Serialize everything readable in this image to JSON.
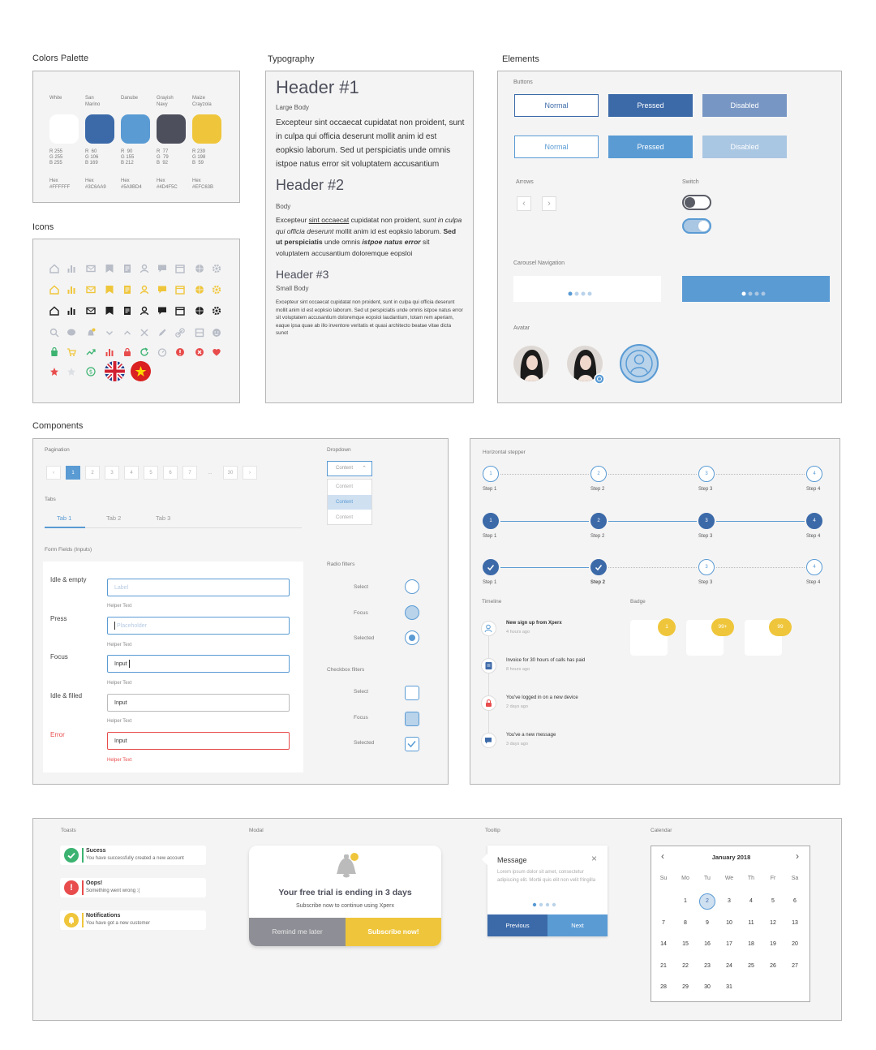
{
  "titles": {
    "colors": "Colors Palette",
    "typography": "Typography",
    "elements": "Elements",
    "icons": "Icons",
    "components": "Components"
  },
  "palette": [
    {
      "name": "White",
      "rgb": "R 255\nG 255\nB 255",
      "hex": "Hex\n#FFFFFF",
      "color": "#FFFFFF"
    },
    {
      "name": "San\nMarino",
      "rgb": "R  60\nG 106\nB 169",
      "hex": "Hex\n#3C6AA9",
      "color": "#3C6AA9"
    },
    {
      "name": "Danube",
      "rgb": "R  90\nG 155\nB 212",
      "hex": "Hex\n#5A9BD4",
      "color": "#5A9BD4"
    },
    {
      "name": "Grayish\nNavy",
      "rgb": "R  77\nG  79\nB  92",
      "hex": "Hex\n#4D4F5C",
      "color": "#4D4F5C"
    },
    {
      "name": "Maize\nCrayzola",
      "rgb": "R 239\nG 198\nB  59",
      "hex": "Hex\n#EFC63B",
      "color": "#EFC63B"
    }
  ],
  "typography": {
    "h1": "Header #1",
    "large_label": "Large Body",
    "large_text": "Excepteur sint occaecat cupidatat non proident, sunt in culpa qui officia deserunt mollit anim id est eopksio laborum. Sed ut perspiciatis unde omnis istpoe natus error sit voluptatem accusantium",
    "h2": "Header #2",
    "body_label": "Body",
    "body_p1": "Excepteur ",
    "body_u": "sint occaecat",
    "body_p2": " cupidatat non proident, ",
    "body_i": "sunt in culpa qui officia deserunt",
    "body_p3": " mollit anim id est eopksio laborum. ",
    "body_b": "Sed ut perspiciatis",
    "body_p4": " unde omnis ",
    "body_bi": "istpoe natus error",
    "body_p5": " sit voluptatem accusantium doloremque eopsloi",
    "h3": "Header #3",
    "small_label": "Small Body",
    "small_text": "Excepteur sint occaecat cupidatat non proident, sunt in culpa qui officia deserunt mollit anim id est eopksio laborum. Sed ut perspiciatis unde omnis istpoe natus error sit voluptatem accusantium doloremque eopsloi laudantium, totam rem aperiam, eaque ipsa quae ab illo inventore veritatis et quasi architecto beatae vitae dicta sunot"
  },
  "elements": {
    "buttons_label": "Buttons",
    "row1": {
      "normal": "Normal",
      "pressed": "Pressed",
      "disabled": "Disabled"
    },
    "row2": {
      "normal": "Normal",
      "pressed": "Pressed",
      "disabled": "Disabled"
    },
    "arrows_label": "Arrows",
    "switch_label": "Switch",
    "carousel_label": "Carousel Navigation",
    "avatar_label": "Avatar"
  },
  "components": {
    "pagination_label": "Pagination",
    "pages": [
      "1",
      "2",
      "3",
      "4",
      "5",
      "6",
      "7",
      "...",
      "30"
    ],
    "tabs_label": "Tabs",
    "tabs": [
      "Tab 1",
      "Tab 2",
      "Tab 3"
    ],
    "form_label": "Form Fields (Inputs)",
    "fields": [
      {
        "state": "Idle & empty",
        "value": "Label",
        "helper": "Helper Text"
      },
      {
        "state": "Press",
        "value": "Placeholder",
        "helper": "Helper Text"
      },
      {
        "state": "Focus",
        "value": "Input",
        "helper": "Helper Text"
      },
      {
        "state": "Idle & filled",
        "value": "Input",
        "helper": "Helper Text"
      },
      {
        "state": "Error",
        "value": "Input",
        "helper": "Helper Text"
      }
    ],
    "dropdown_label": "Dropdown",
    "dropdown_value": "Content",
    "dropdown_options": [
      "Content",
      "Content",
      "Content"
    ],
    "radio_label": "Radio filters",
    "checkbox_label": "Checkbox filters",
    "filter_states": [
      "Select",
      "Focus",
      "Selected"
    ]
  },
  "stepper": {
    "label": "Horizontal stepper",
    "rows": [
      {
        "nums": [
          "1",
          "2",
          "3",
          "4"
        ],
        "labels": [
          "Step 1",
          "Step 2",
          "Step 3",
          "Step 4"
        ]
      },
      {
        "nums": [
          "1",
          "2",
          "3",
          "4"
        ],
        "labels": [
          "Step 1",
          "Step 2",
          "Step 3",
          "Step 4"
        ]
      },
      {
        "nums": [
          "",
          "",
          "3",
          "4"
        ],
        "labels": [
          "Step 1",
          "Step 2",
          "Step 3",
          "Step 4"
        ]
      }
    ]
  },
  "timeline": {
    "label": "Timeline",
    "items": [
      {
        "title": "New sign up from Xperx",
        "time": "4 hours ago"
      },
      {
        "title": "Invoice for 30 hours of calls has paid",
        "time": "8 hours ago"
      },
      {
        "title": "You've logged in on a new device",
        "time": "2 days ago"
      },
      {
        "title": "You've a new message",
        "time": "3 days ago"
      }
    ]
  },
  "badge": {
    "label": "Badge",
    "values": [
      "1",
      "99+",
      "99"
    ]
  },
  "toasts": {
    "label": "Toasts",
    "items": [
      {
        "title": "Sucess",
        "text": "You have successfully created a new account",
        "color": "#3cb371"
      },
      {
        "title": "Oops!",
        "text": "Something went wrong :(",
        "color": "#e84c4c"
      },
      {
        "title": "Notifications",
        "text": "You have got a new customer",
        "color": "#efc63b"
      }
    ]
  },
  "modal": {
    "label": "Modal",
    "title": "Your free trial is ending in 3 days",
    "text": "Subscribe now to continue using Xperx",
    "secondary": "Remind me later",
    "primary": "Subscribe now!"
  },
  "tooltip": {
    "label": "Tooltip",
    "title": "Message",
    "text": "Lorem ipsum dolor sit amet, consectetur adipiscing elit. Morbi quis elit non velit fringilla",
    "prev": "Previous",
    "next": "Next"
  },
  "calendar": {
    "label": "Calendar",
    "month": "January 2018",
    "weekdays": [
      "Su",
      "Mo",
      "Tu",
      "We",
      "Th",
      "Fr",
      "Sa"
    ],
    "selected": "2",
    "weeks": [
      [
        "",
        "1",
        "2",
        "3",
        "4",
        "5",
        "6"
      ],
      [
        "7",
        "8",
        "9",
        "10",
        "11",
        "12",
        "13"
      ],
      [
        "14",
        "15",
        "16",
        "17",
        "18",
        "19",
        "20"
      ],
      [
        "21",
        "22",
        "23",
        "24",
        "25",
        "26",
        "27"
      ],
      [
        "28",
        "29",
        "30",
        "31",
        "",
        "",
        ""
      ]
    ]
  }
}
